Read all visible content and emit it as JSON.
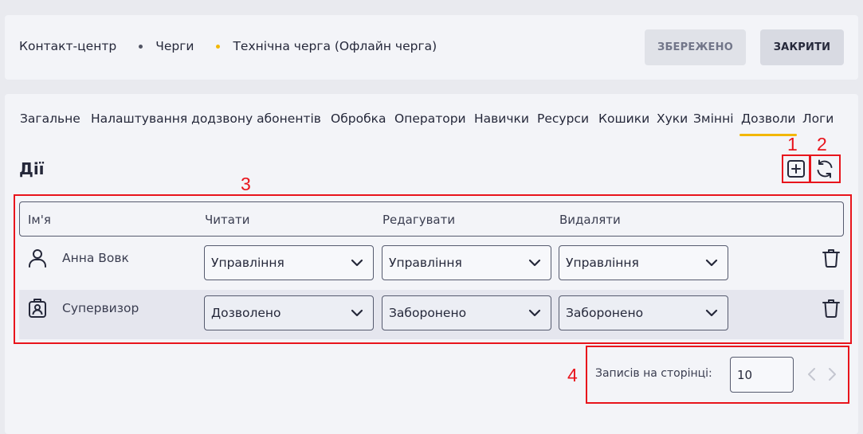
{
  "breadcrumb": [
    "Контакт-центр",
    "Черги",
    "Технічна черга (Офлайн черга)"
  ],
  "colors": {
    "accent": "#f2b705",
    "marker": "#e8141c",
    "border": "#555a6e"
  },
  "actions": {
    "saved_label": "ЗБЕРЕЖЕНО",
    "close_label": "ЗАКРИТИ"
  },
  "tabs": [
    {
      "label": "Загальне"
    },
    {
      "label": "Налаштування додзвону абонентів"
    },
    {
      "label": "Обробка"
    },
    {
      "label": "Оператори"
    },
    {
      "label": "Навички"
    },
    {
      "label": "Ресурси"
    },
    {
      "label": "Кошики"
    },
    {
      "label": "Хуки"
    },
    {
      "label": "Змінні"
    },
    {
      "label": "Дозволи",
      "active": true
    },
    {
      "label": "Логи"
    }
  ],
  "section": {
    "title": "Дії"
  },
  "markers": [
    "1",
    "2",
    "3",
    "4"
  ],
  "table": {
    "headers": [
      "Ім'я",
      "Читати",
      "Редагувати",
      "Видаляти"
    ],
    "rows": [
      {
        "name": "Анна Вовк",
        "icon": "user-icon",
        "read": "Управління",
        "edit": "Управління",
        "delete": "Управління"
      },
      {
        "name": "Супервизор",
        "icon": "badge-icon",
        "read": "Дозволено",
        "edit": "Заборонено",
        "delete": "Заборонено"
      }
    ]
  },
  "pagination": {
    "label": "Записів на сторінці:",
    "per_page": "10"
  }
}
